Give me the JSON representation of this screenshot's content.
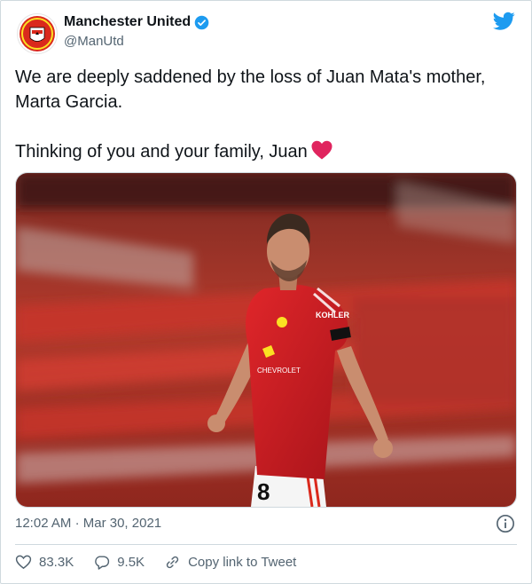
{
  "account": {
    "name": "Manchester United",
    "handle": "@ManUtd",
    "brand_color": "#DA291C"
  },
  "tweet": {
    "line1": "We are deeply saddened by the loss of Juan Mata's mother, Marta Garcia.",
    "line2": "Thinking of you and your family, Juan",
    "heart_color": "#e0245e",
    "photo_alt_icon": "player-photo",
    "jersey_sponsor": "KOHLER",
    "jersey_shirt_sponsor": "CHEVROLET",
    "jersey_number": "8"
  },
  "meta": {
    "time": "12:02 AM",
    "separator": "·",
    "date": "Mar 30, 2021"
  },
  "actions": {
    "likes": "83.3K",
    "replies": "9.5K",
    "copy_link": "Copy link to Tweet"
  },
  "colors": {
    "twitter_blue": "#1d9bf0",
    "muted": "#536471",
    "border": "#cfd9de"
  }
}
